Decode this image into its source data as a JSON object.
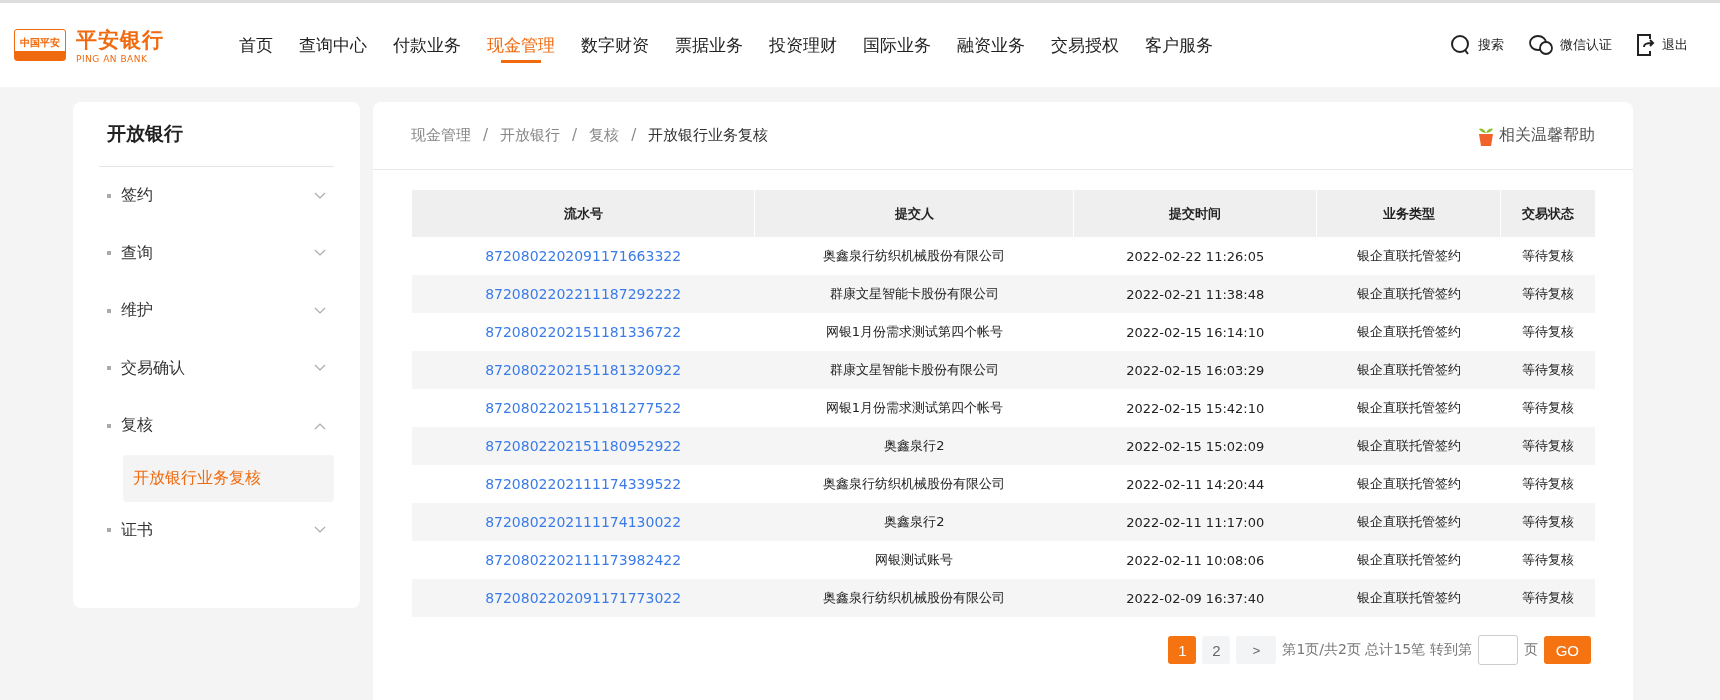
{
  "header": {
    "logo": {
      "badge": "中国平安",
      "name": "平安银行",
      "subtitle": "PING AN BANK"
    },
    "nav": [
      {
        "label": "首页",
        "selected": false
      },
      {
        "label": "查询中心",
        "selected": false
      },
      {
        "label": "付款业务",
        "selected": false
      },
      {
        "label": "现金管理",
        "selected": true
      },
      {
        "label": "数字财资",
        "selected": false
      },
      {
        "label": "票据业务",
        "selected": false
      },
      {
        "label": "投资理财",
        "selected": false
      },
      {
        "label": "国际业务",
        "selected": false
      },
      {
        "label": "融资业务",
        "selected": false
      },
      {
        "label": "交易授权",
        "selected": false
      },
      {
        "label": "客户服务",
        "selected": false
      }
    ],
    "actions": [
      {
        "kind": "search",
        "label": "搜索"
      },
      {
        "kind": "wechat",
        "label": "微信认证"
      },
      {
        "kind": "logout",
        "label": "退出"
      }
    ]
  },
  "sidebar": {
    "title": "开放银行",
    "items": [
      {
        "label": "签约",
        "expanded": false
      },
      {
        "label": "查询",
        "expanded": false
      },
      {
        "label": "维护",
        "expanded": false
      },
      {
        "label": "交易确认",
        "expanded": false
      },
      {
        "label": "复核",
        "expanded": true,
        "children": [
          {
            "label": "开放银行业务复核",
            "selected": true
          }
        ]
      },
      {
        "label": "证书",
        "expanded": false
      }
    ]
  },
  "breadcrumb": {
    "separator": "/",
    "items": [
      "现金管理",
      "开放银行",
      "复核",
      "开放银行业务复核"
    ]
  },
  "help": "相关温馨帮助",
  "table": {
    "columns": [
      "流水号",
      "提交人",
      "提交时间",
      "业务类型",
      "交易状态"
    ],
    "rows": [
      [
        "8720802202091171663322",
        "奥鑫泉行纺织机械股份有限公司",
        "2022-02-22 11:26:05",
        "银企直联托管签约",
        "等待复核"
      ],
      [
        "8720802202211187292222",
        "群康文星智能卡股份有限公司",
        "2022-02-21 11:38:48",
        "银企直联托管签约",
        "等待复核"
      ],
      [
        "8720802202151181336722",
        "网银1月份需求测试第四个帐号",
        "2022-02-15 16:14:10",
        "银企直联托管签约",
        "等待复核"
      ],
      [
        "8720802202151181320922",
        "群康文星智能卡股份有限公司",
        "2022-02-15 16:03:29",
        "银企直联托管签约",
        "等待复核"
      ],
      [
        "8720802202151181277522",
        "网银1月份需求测试第四个帐号",
        "2022-02-15 15:42:10",
        "银企直联托管签约",
        "等待复核"
      ],
      [
        "8720802202151180952922",
        "奥鑫泉行2",
        "2022-02-15 15:02:09",
        "银企直联托管签约",
        "等待复核"
      ],
      [
        "8720802202111174339522",
        "奥鑫泉行纺织机械股份有限公司",
        "2022-02-11 14:20:44",
        "银企直联托管签约",
        "等待复核"
      ],
      [
        "8720802202111174130022",
        "奥鑫泉行2",
        "2022-02-11 11:17:00",
        "银企直联托管签约",
        "等待复核"
      ],
      [
        "8720802202111173982422",
        "网银测试账号",
        "2022-02-11 10:08:06",
        "银企直联托管签约",
        "等待复核"
      ],
      [
        "8720802202091171773022",
        "奥鑫泉行纺织机械股份有限公司",
        "2022-02-09 16:37:40",
        "银企直联托管签约",
        "等待复核"
      ]
    ]
  },
  "pagination": {
    "pages": [
      {
        "label": "1",
        "selected": true
      },
      {
        "label": "2",
        "selected": false
      }
    ],
    "next": ">",
    "summary": "第1页/共2页 总计15笔 转到第",
    "suffix": "页",
    "go": "GO"
  }
}
